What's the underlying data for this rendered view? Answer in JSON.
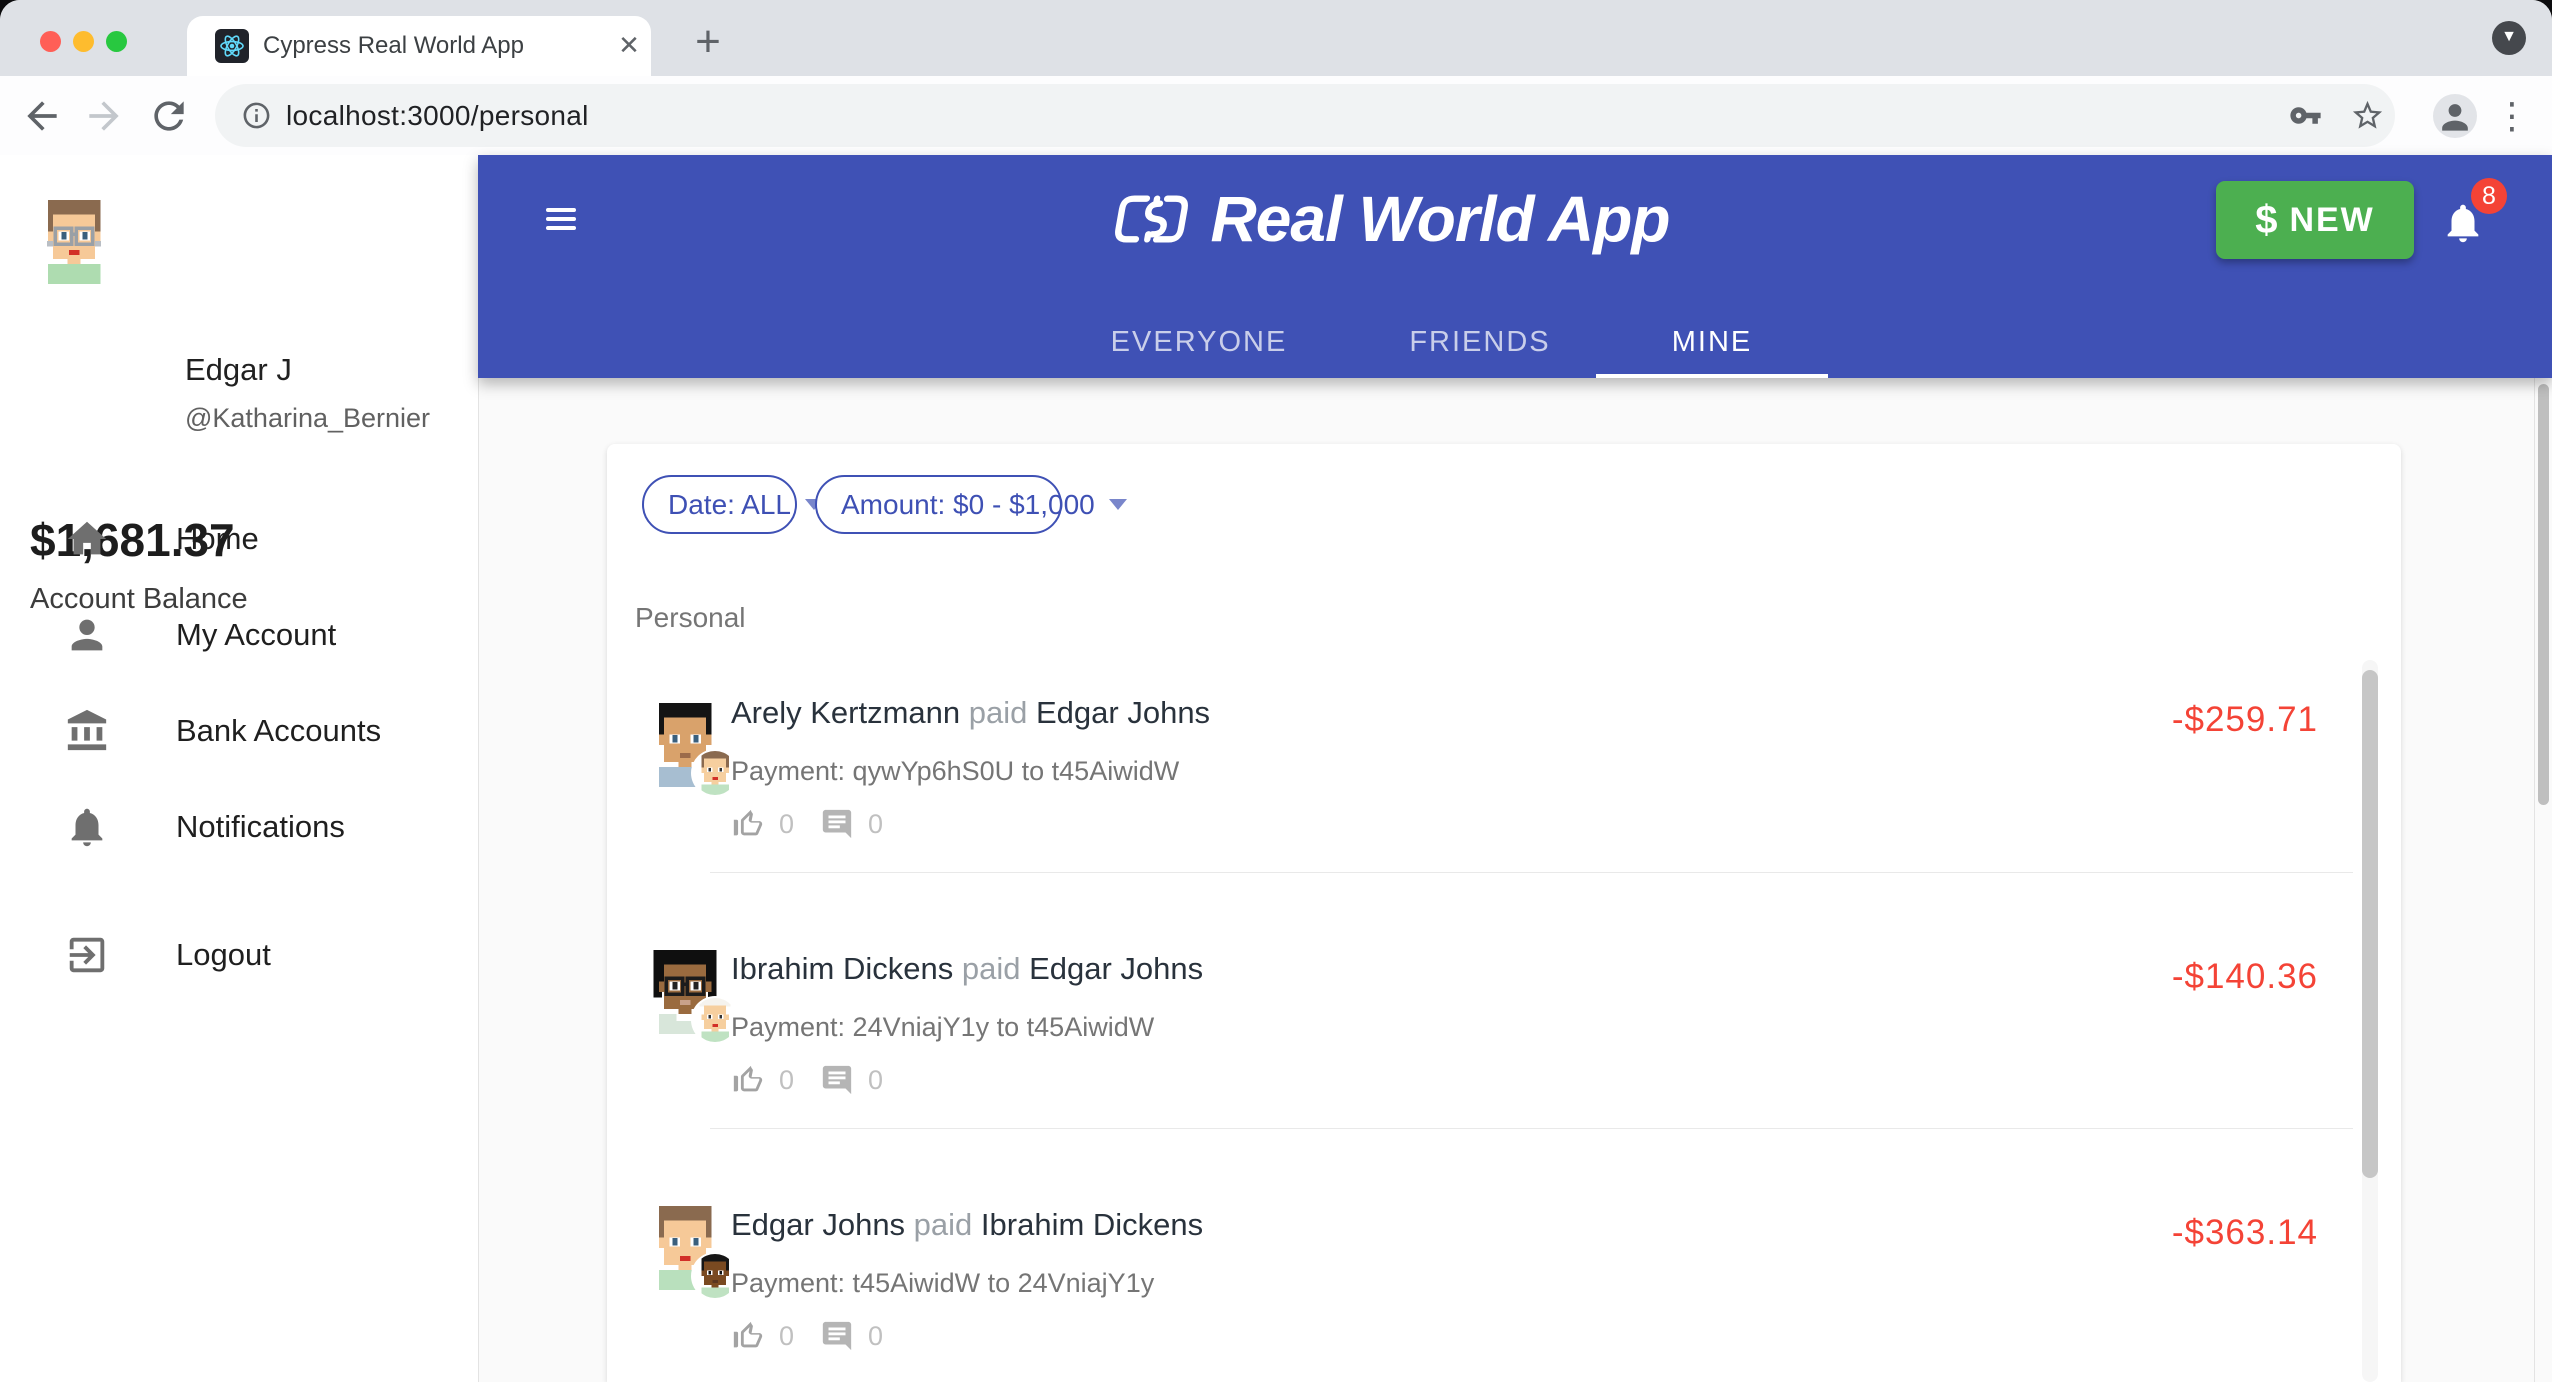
{
  "browser": {
    "tab_title": "Cypress Real World App",
    "close_glyph": "✕",
    "new_tab_glyph": "+",
    "tab_search_glyph": "▼",
    "url": "localhost:3000/personal",
    "menu_glyph": "⋮"
  },
  "header": {
    "logo_text": "Real World App",
    "tabs": [
      {
        "label": "EVERYONE",
        "active": false
      },
      {
        "label": "FRIENDS",
        "active": false
      },
      {
        "label": "MINE",
        "active": true
      }
    ],
    "new_button_symbol": "$",
    "new_button_label": "NEW",
    "notification_count": "8"
  },
  "sidebar": {
    "name": "Edgar J",
    "handle": "@Katharina_Bernier",
    "balance": "$1,681.37",
    "balance_label": "Account Balance",
    "nav": [
      {
        "label": "Home",
        "icon": "home-icon"
      },
      {
        "label": "My Account",
        "icon": "person-icon"
      },
      {
        "label": "Bank Accounts",
        "icon": "bank-icon"
      },
      {
        "label": "Notifications",
        "icon": "bell-icon"
      }
    ],
    "logout_label": "Logout"
  },
  "main": {
    "filters": {
      "date": "Date: ALL",
      "amount": "Amount: $0 - $1,000"
    },
    "section_label": "Personal",
    "transactions": [
      {
        "sender": "Arely Kertzmann",
        "action": "paid",
        "receiver": "Edgar Johns",
        "description": "Payment: qywYp6hS0U to t45AiwidW",
        "likes": "0",
        "comments": "0",
        "amount": "-$259.71"
      },
      {
        "sender": "Ibrahim Dickens",
        "action": "paid",
        "receiver": "Edgar Johns",
        "description": "Payment: 24VniajY1y to t45AiwidW",
        "likes": "0",
        "comments": "0",
        "amount": "-$140.36"
      },
      {
        "sender": "Edgar Johns",
        "action": "paid",
        "receiver": "Ibrahim Dickens",
        "description": "Payment: t45AiwidW to 24VniajY1y",
        "likes": "0",
        "comments": "0",
        "amount": "-$363.14"
      }
    ]
  },
  "colors": {
    "appbar": "#3f51b5",
    "new_button": "#4caf50",
    "amount_negative": "#f44336",
    "badge": "#f44336",
    "chip": "#3f51b5",
    "react_teal": "#61dafb"
  },
  "avatars": {
    "sidebar": {
      "hair": "#8a6a4f",
      "skin": "#f6c998",
      "mouth": "#d22f27",
      "shirt": "#aedcb0",
      "glasses": "#9aa0a6",
      "earrings": "#b9bec4",
      "eyes": "#3a5f7d"
    },
    "rows": [
      {
        "main": {
          "hair": "#141414",
          "skin": "#d9a26b",
          "shirt": "#a7bed1",
          "mouth": "#9c6b4a",
          "eyes": "#3a5f7d"
        },
        "child": {
          "hair": "#8a6a4f",
          "skin": "#f6cf9f",
          "shirt": "#bfe2c2",
          "mouth": "#d22f27",
          "eyes": "#333333"
        }
      },
      {
        "main": {
          "afro": true,
          "hair": "#0f0f0f",
          "skin": "#9a6b3f",
          "shirt": "#d8e6da",
          "collar": "#ffffff",
          "glasses": "#1c1c1c",
          "mouth": "#c9a18a",
          "eyes": "#222222"
        },
        "child": {
          "hat": "#f5f3ee",
          "skin": "#f6cf9f",
          "shirt": "#bfe2c2",
          "mouth": "#d22f27",
          "eyes": "#333333"
        }
      },
      {
        "main": {
          "hair": "#8a6a4f",
          "skin": "#f6c998",
          "shirt": "#b9e0bd",
          "mouth": "#d22f27",
          "eyes": "#3a5f7d"
        },
        "child": {
          "hair": "#161616",
          "skin": "#7a4a21",
          "shirt": "#bfe2c2",
          "mouth": "#5a3620",
          "eyes": "#111111"
        }
      }
    ]
  }
}
